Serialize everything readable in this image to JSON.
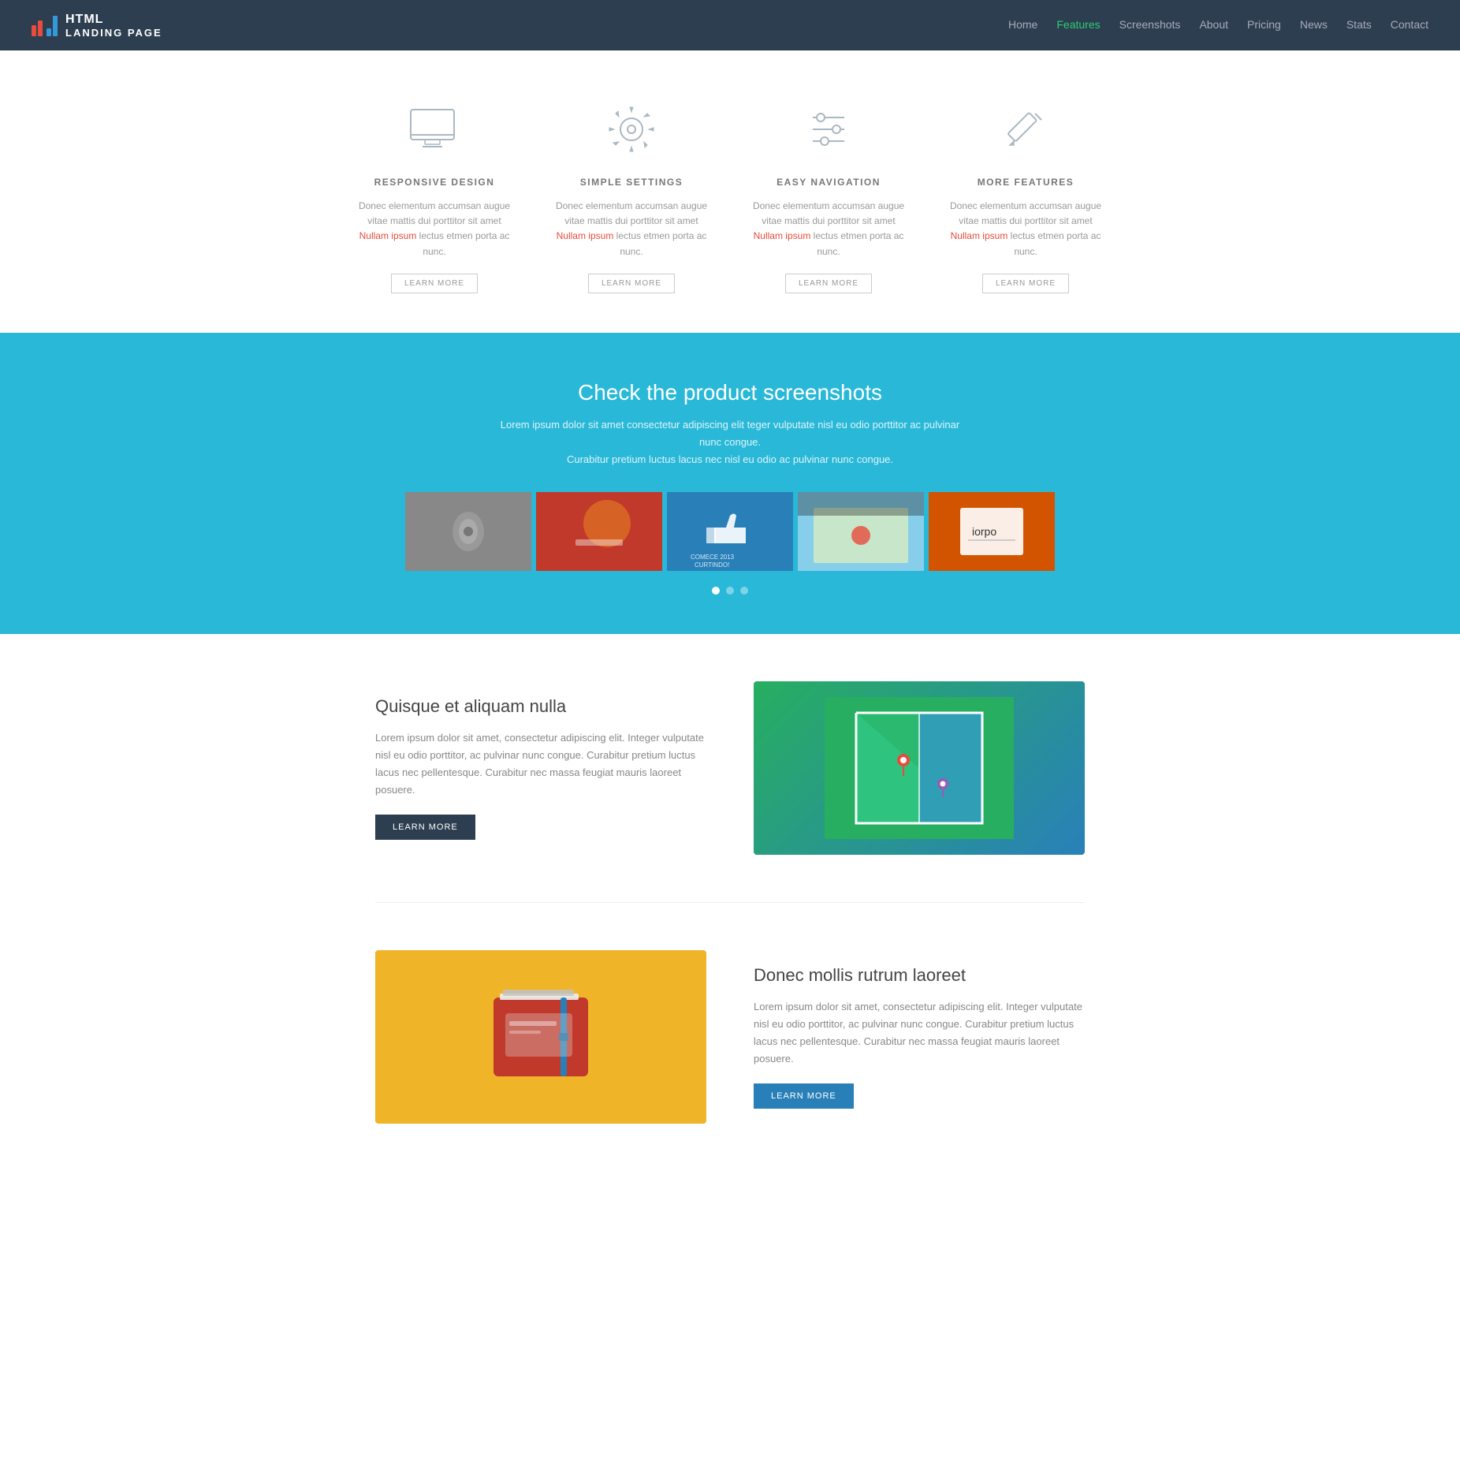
{
  "navbar": {
    "brand_html": "HTML",
    "brand_landing": "LANDING PAGE",
    "nav_items": [
      {
        "label": "Home",
        "active": false
      },
      {
        "label": "Features",
        "active": true
      },
      {
        "label": "Screenshots",
        "active": false
      },
      {
        "label": "About",
        "active": false
      },
      {
        "label": "Pricing",
        "active": false
      },
      {
        "label": "News",
        "active": false
      },
      {
        "label": "Stats",
        "active": false
      },
      {
        "label": "Contact",
        "active": false
      }
    ]
  },
  "features": {
    "cards": [
      {
        "id": "responsive",
        "title": "RESPONSIVE DESIGN",
        "desc": "Donec elementum accumsan augue vitae mattis dui porttitor sit amet Nullam ipsum lectus etmen porta ac nunc.",
        "button": "LEARN MORE"
      },
      {
        "id": "settings",
        "title": "SIMPLE SETTINGS",
        "desc": "Donec elementum accumsan augue vitae mattis dui porttitor sit amet Nullam ipsum lectus etmen porta ac nunc.",
        "button": "LEARN MORE"
      },
      {
        "id": "navigation",
        "title": "EASY NAVIGATION",
        "desc": "Donec elementum accumsan augue vitae mattis dui porttitor sit amet Nullam ipsum lectus etmen porta ac nunc.",
        "button": "LEARN MORE"
      },
      {
        "id": "more",
        "title": "MORE FEATURES",
        "desc": "Donec elementum accumsan augue vitae mattis dui porttitor sit amet Nullam ipsum lectus etmen porta ac nunc.",
        "button": "LEARN MORE"
      }
    ]
  },
  "screenshots": {
    "heading": "Check the product screenshots",
    "desc_line1": "Lorem ipsum dolor sit amet consectetur adipiscing elit teger vulputate nisl eu odio porttitor ac pulvinar nunc congue.",
    "desc_line2": "Curabitur pretium luctus lacus nec nisl eu odio ac pulvinar nunc congue.",
    "dots": [
      {
        "active": true
      },
      {
        "active": false
      },
      {
        "active": false
      }
    ]
  },
  "feature_blocks": [
    {
      "id": "map",
      "title": "Quisque et aliquam nulla",
      "desc": "Lorem ipsum dolor sit amet, consectetur adipiscing elit. Integer vulputate nisl eu odio porttitor, ac pulvinar nunc congue. Curabitur pretium luctus lacus nec pellentesque. Curabitur nec massa feugiat mauris laoreet posuere.",
      "button": "LEARN MORE",
      "image_type": "map"
    },
    {
      "id": "wallet",
      "title": "Donec mollis rutrum laoreet",
      "desc": "Lorem ipsum dolor sit amet, consectetur adipiscing elit. Integer vulputate nisl eu odio porttitor, ac pulvinar nunc congue. Curabitur pretium luctus lacus nec pellentesque. Curabitur nec massa feugiat mauris laoreet posuere.",
      "button": "LEARN MORE",
      "image_type": "wallet"
    }
  ]
}
